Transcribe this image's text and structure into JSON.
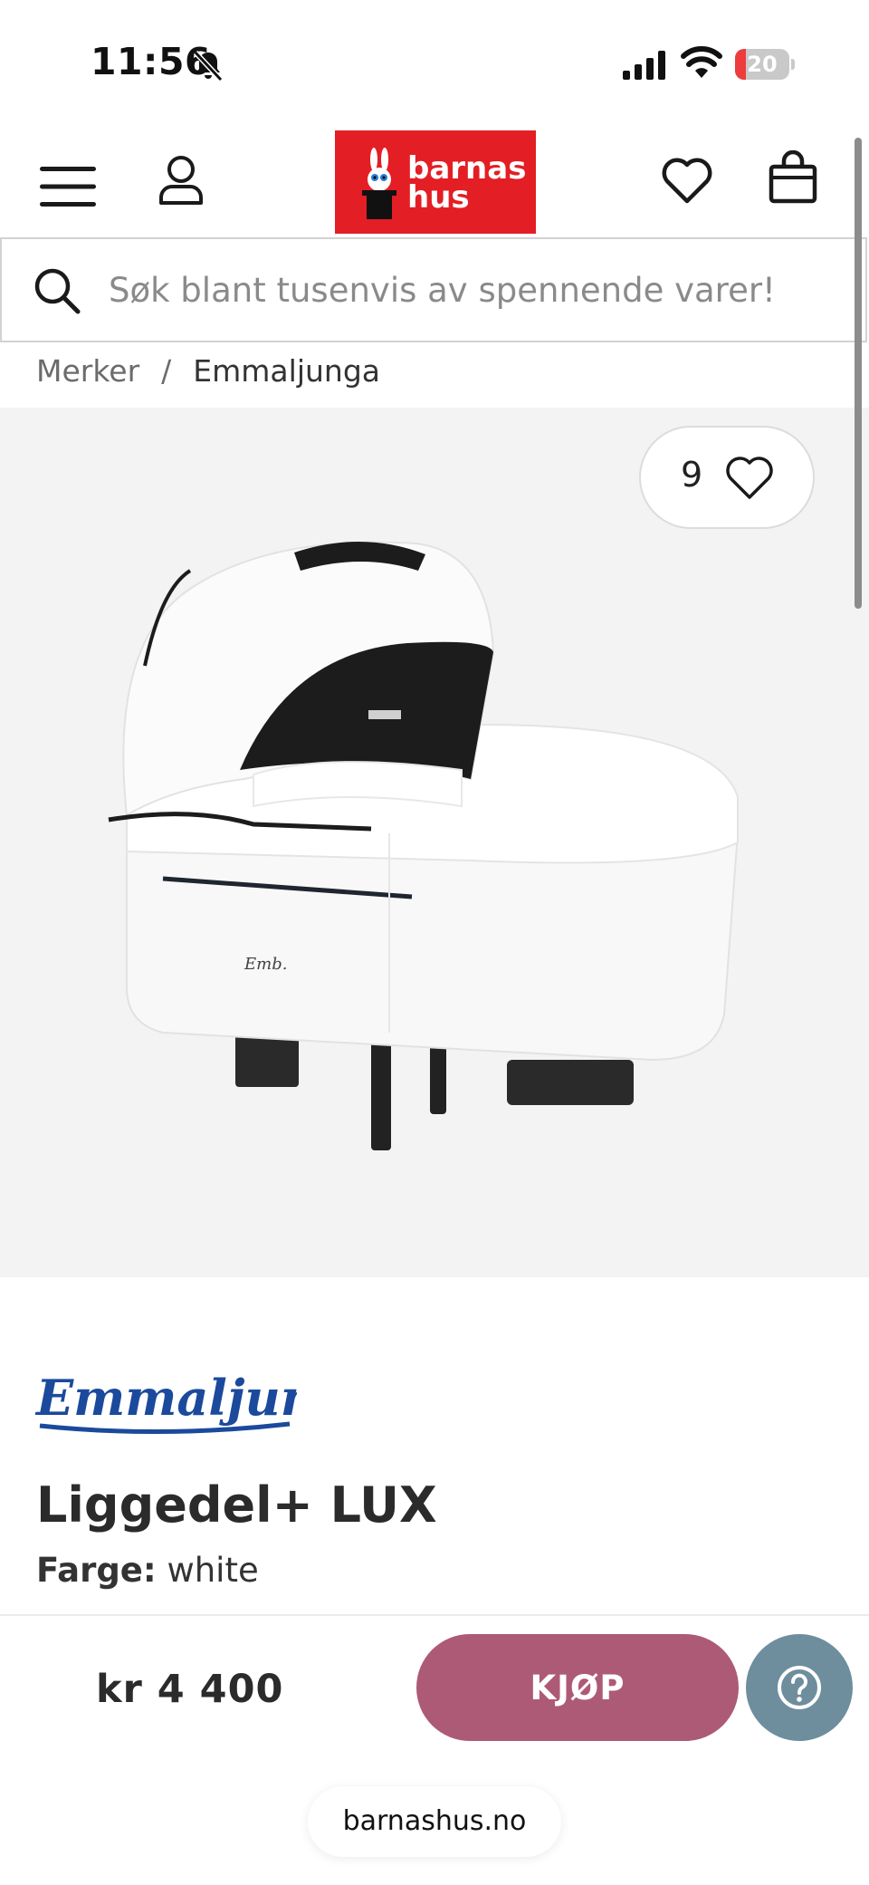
{
  "status_bar": {
    "time": "11:56",
    "battery_level": "20",
    "battery_fraction": 0.2,
    "icons": [
      "bell-slash-icon",
      "cellular-signal-icon",
      "wifi-icon",
      "battery-icon"
    ]
  },
  "header": {
    "logo_line1": "barnas",
    "logo_line2": "hus",
    "icons": [
      "menu-icon",
      "account-icon",
      "wishlist-icon",
      "shopping-bag-icon"
    ],
    "brand_color": "#e31e24"
  },
  "search": {
    "placeholder": "Søk blant tusenvis av spennende varer!"
  },
  "breadcrumb": {
    "items": [
      "Merker",
      "Emmaljunga"
    ],
    "separator": "/"
  },
  "product": {
    "wishlist_count": "9",
    "brand_name": "Emmaljunga",
    "brand_color": "#1b4a9c",
    "title": "Liggedel+ LUX",
    "color_label": "Farge:",
    "color_value": "white"
  },
  "buy_bar": {
    "price": "kr 4 400",
    "buy_label": "KJØP",
    "buy_color": "#ad5a76",
    "help_color": "#6e8e9e",
    "help_icon": "question-circle-icon"
  },
  "browser": {
    "url": "barnashus.no"
  }
}
